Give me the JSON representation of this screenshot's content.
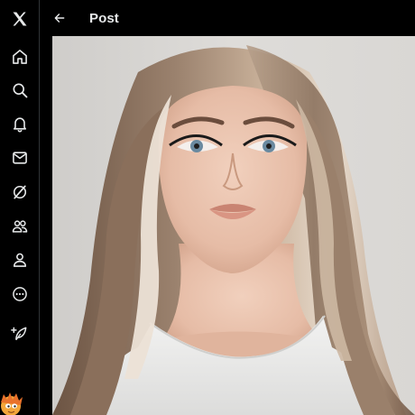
{
  "header": {
    "title": "Post"
  },
  "sidebar": {
    "items": [
      {
        "name": "x-logo-icon"
      },
      {
        "name": "home-icon"
      },
      {
        "name": "explore-icon"
      },
      {
        "name": "notifications-icon"
      },
      {
        "name": "messages-icon"
      },
      {
        "name": "grok-icon"
      },
      {
        "name": "communities-icon"
      },
      {
        "name": "profile-icon"
      },
      {
        "name": "more-icon"
      },
      {
        "name": "post-icon"
      }
    ]
  },
  "colors": {
    "background": "#000000",
    "text": "#e7e9ea",
    "divider": "#2f3336"
  }
}
